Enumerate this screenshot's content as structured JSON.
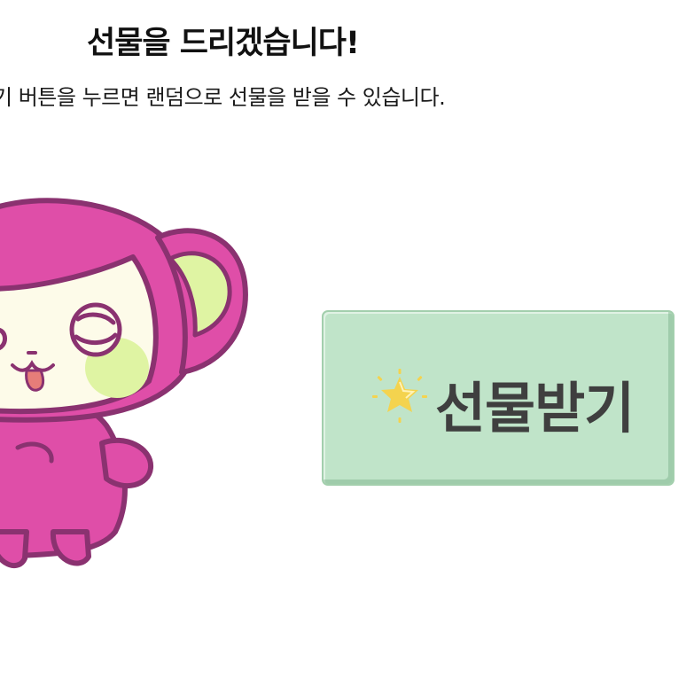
{
  "page": {
    "title": "선물을 드리겠습니다!",
    "subtitle": "기 버튼을 누르면 랜덤으로 선물을 받을 수 있습니다."
  },
  "gift_button": {
    "label": "선물받기",
    "icon": "sparkle-star-icon"
  },
  "colors": {
    "button_bg": "#c0e4c9",
    "button_border": "#a3cfad",
    "mascot_pink": "#df4ea8",
    "mascot_outline": "#8a3270",
    "mascot_face": "#fdfbe9",
    "mascot_cheek": "#dff4a3",
    "star": "#f4d34e"
  }
}
